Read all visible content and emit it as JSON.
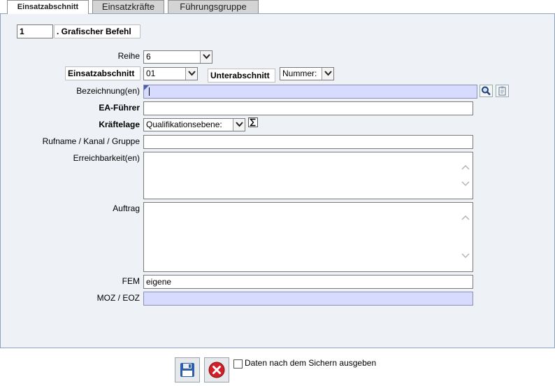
{
  "tabs": [
    {
      "label": "Einsatzabschnitt"
    },
    {
      "label": "Einsatzkräfte"
    },
    {
      "label": "Führungsgruppe"
    }
  ],
  "header": {
    "number_value": "1",
    "title": ". Grafischer Befehl"
  },
  "form": {
    "reihe": {
      "label": "Reihe",
      "value": "6"
    },
    "einsatzabschnitt": {
      "label": "Einsatzabschnitt",
      "value": "01"
    },
    "unterabschnitt": {
      "label": "Unterabschnitt",
      "value": "Nummer:"
    },
    "bezeichnung": {
      "label": "Bezeichnung(en)",
      "value": ""
    },
    "ea_fuehrer": {
      "label": "EA-Führer",
      "value": ""
    },
    "kraeftelage": {
      "label": "Kräftelage",
      "value": "Qualifikationsebene:"
    },
    "rufname": {
      "label": "Rufname / Kanal / Gruppe",
      "value": ""
    },
    "erreichbarkeit": {
      "label": "Erreichbarkeit(en)",
      "value": ""
    },
    "auftrag": {
      "label": "Auftrag",
      "value": ""
    },
    "fem": {
      "label": "FEM",
      "value": "eigene"
    },
    "moz_eoz": {
      "label": "MOZ / EOZ",
      "value": ""
    }
  },
  "footer": {
    "checkbox_label": "Daten nach dem Sichern ausgeben",
    "checkbox_checked": false
  },
  "icons": {
    "search": "magnifier-icon",
    "clipboard": "clipboard-icon",
    "sum": "sigma-icon",
    "save": "floppy-disk-icon",
    "cancel": "red-x-icon"
  },
  "colors": {
    "highlight_field": "#d7dcff",
    "panel_bg": "#eef1f6",
    "cancel_red": "#d0202a"
  }
}
